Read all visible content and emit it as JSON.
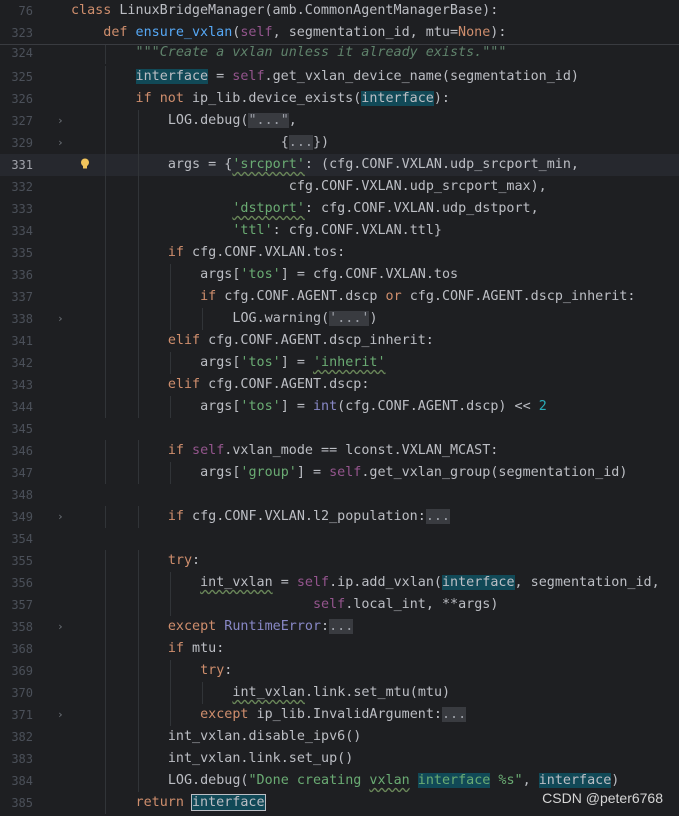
{
  "sticky": [
    {
      "ln": "76",
      "indent": 0,
      "tokens": [
        [
          "kw",
          "class"
        ],
        [
          "t",
          " LinuxBridgeManager(amb.CommonAgentManagerBase):"
        ]
      ]
    },
    {
      "ln": "323",
      "indent": 1,
      "tokens": [
        [
          "kw",
          "def"
        ],
        [
          "t",
          " "
        ],
        [
          "fn",
          "ensure_vxlan"
        ],
        [
          "t",
          "("
        ],
        [
          "self",
          "self"
        ],
        [
          "t",
          ", segmentation_id, mtu="
        ],
        [
          "kw",
          "None"
        ],
        [
          "t",
          "):"
        ]
      ]
    }
  ],
  "lines": [
    {
      "ln": "324",
      "indent": 2,
      "partial": true,
      "tokens": [
        [
          "doc",
          "\"\"\"Create a vxlan unless it already exists.\"\"\""
        ]
      ]
    },
    {
      "ln": "325",
      "indent": 2,
      "tokens": [
        [
          "hl",
          "interface"
        ],
        [
          "t",
          " = "
        ],
        [
          "self",
          "self"
        ],
        [
          "t",
          ".get_vxlan_device_name(segmentation_id)"
        ]
      ]
    },
    {
      "ln": "326",
      "indent": 2,
      "tokens": [
        [
          "kw",
          "if not"
        ],
        [
          "t",
          " ip_lib.device_exists("
        ],
        [
          "hl",
          "interface"
        ],
        [
          "t",
          "):"
        ]
      ]
    },
    {
      "ln": "327",
      "indent": 3,
      "fold": true,
      "tokens": [
        [
          "t",
          "LOG.debug("
        ],
        [
          "strfold",
          "\"...\""
        ],
        [
          "t",
          ","
        ]
      ]
    },
    {
      "ln": "329",
      "indent": 3,
      "fold": true,
      "extra": "              ",
      "tokens": [
        [
          "t",
          "{"
        ],
        [
          "fold",
          "..."
        ],
        [
          "t",
          "})"
        ]
      ]
    },
    {
      "ln": "331",
      "indent": 3,
      "current": true,
      "bulb": true,
      "tokens": [
        [
          "t",
          "args = {"
        ],
        [
          "strw",
          "'srcport'"
        ],
        [
          "t",
          ": (cfg.CONF.VXLAN.udp_srcport_min,"
        ]
      ]
    },
    {
      "ln": "332",
      "indent": 3,
      "extra": "               ",
      "tokens": [
        [
          "t",
          "cfg.CONF.VXLAN.udp_srcport_max),"
        ]
      ]
    },
    {
      "ln": "333",
      "indent": 3,
      "extra": "        ",
      "tokens": [
        [
          "strw",
          "'dstport'"
        ],
        [
          "t",
          ": cfg.CONF.VXLAN.udp_dstport,"
        ]
      ]
    },
    {
      "ln": "334",
      "indent": 3,
      "extra": "        ",
      "tokens": [
        [
          "str",
          "'ttl'"
        ],
        [
          "t",
          ": cfg.CONF.VXLAN.ttl}"
        ]
      ]
    },
    {
      "ln": "335",
      "indent": 3,
      "tokens": [
        [
          "kw",
          "if"
        ],
        [
          "t",
          " cfg.CONF.VXLAN.tos:"
        ]
      ]
    },
    {
      "ln": "336",
      "indent": 4,
      "tokens": [
        [
          "t",
          "args["
        ],
        [
          "str",
          "'tos'"
        ],
        [
          "t",
          "] = cfg.CONF.VXLAN.tos"
        ]
      ]
    },
    {
      "ln": "337",
      "indent": 4,
      "tokens": [
        [
          "kw",
          "if"
        ],
        [
          "t",
          " cfg.CONF.AGENT.dscp "
        ],
        [
          "kw",
          "or"
        ],
        [
          "t",
          " cfg.CONF.AGENT.dscp_inherit:"
        ]
      ]
    },
    {
      "ln": "338",
      "indent": 5,
      "fold": true,
      "tokens": [
        [
          "t",
          "LOG.warning("
        ],
        [
          "strfold",
          "'...'"
        ],
        [
          "t",
          ")"
        ]
      ]
    },
    {
      "ln": "341",
      "indent": 3,
      "tokens": [
        [
          "kw",
          "elif"
        ],
        [
          "t",
          " cfg.CONF.AGENT.dscp_inherit:"
        ]
      ]
    },
    {
      "ln": "342",
      "indent": 4,
      "tokens": [
        [
          "t",
          "args["
        ],
        [
          "str",
          "'tos'"
        ],
        [
          "t",
          "] = "
        ],
        [
          "strw",
          "'inherit'"
        ]
      ]
    },
    {
      "ln": "343",
      "indent": 3,
      "tokens": [
        [
          "kw",
          "elif"
        ],
        [
          "t",
          " cfg.CONF.AGENT.dscp:"
        ]
      ]
    },
    {
      "ln": "344",
      "indent": 4,
      "tokens": [
        [
          "t",
          "args["
        ],
        [
          "str",
          "'tos'"
        ],
        [
          "t",
          "] = "
        ],
        [
          "builtin",
          "int"
        ],
        [
          "t",
          "(cfg.CONF.AGENT.dscp) << "
        ],
        [
          "num",
          "2"
        ]
      ]
    },
    {
      "ln": "345",
      "indent": 0,
      "tokens": []
    },
    {
      "ln": "346",
      "indent": 3,
      "tokens": [
        [
          "kw",
          "if"
        ],
        [
          "t",
          " "
        ],
        [
          "self",
          "self"
        ],
        [
          "t",
          ".vxlan_mode == lconst.VXLAN_MCAST:"
        ]
      ]
    },
    {
      "ln": "347",
      "indent": 4,
      "tokens": [
        [
          "t",
          "args["
        ],
        [
          "str",
          "'group'"
        ],
        [
          "t",
          "] = "
        ],
        [
          "self",
          "self"
        ],
        [
          "t",
          ".get_vxlan_group(segmentation_id)"
        ]
      ]
    },
    {
      "ln": "348",
      "indent": 0,
      "tokens": []
    },
    {
      "ln": "349",
      "indent": 3,
      "fold": true,
      "tokens": [
        [
          "kw",
          "if"
        ],
        [
          "t",
          " cfg.CONF.VXLAN.l2_population:"
        ],
        [
          "fold",
          "..."
        ]
      ]
    },
    {
      "ln": "354",
      "indent": 0,
      "tokens": []
    },
    {
      "ln": "355",
      "indent": 3,
      "tokens": [
        [
          "kw",
          "try"
        ],
        [
          "t",
          ":"
        ]
      ]
    },
    {
      "ln": "356",
      "indent": 4,
      "tokens": [
        [
          "w",
          "int_vxlan"
        ],
        [
          "t",
          " = "
        ],
        [
          "self",
          "self"
        ],
        [
          "t",
          ".ip.add_vxlan("
        ],
        [
          "hl",
          "interface"
        ],
        [
          "t",
          ", segmentation_id,"
        ]
      ]
    },
    {
      "ln": "357",
      "indent": 4,
      "extra": "              ",
      "tokens": [
        [
          "self",
          "self"
        ],
        [
          "t",
          ".local_int, **args)"
        ]
      ]
    },
    {
      "ln": "358",
      "indent": 3,
      "fold": true,
      "tokens": [
        [
          "kw",
          "except"
        ],
        [
          "t",
          " "
        ],
        [
          "builtin",
          "RuntimeError"
        ],
        [
          "t",
          ":"
        ],
        [
          "fold",
          "..."
        ]
      ]
    },
    {
      "ln": "368",
      "indent": 3,
      "tokens": [
        [
          "kw",
          "if"
        ],
        [
          "t",
          " mtu:"
        ]
      ]
    },
    {
      "ln": "369",
      "indent": 4,
      "tokens": [
        [
          "kw",
          "try"
        ],
        [
          "t",
          ":"
        ]
      ]
    },
    {
      "ln": "370",
      "indent": 5,
      "tokens": [
        [
          "w",
          "int_vxlan"
        ],
        [
          "t",
          ".link.set_mtu(mtu)"
        ]
      ]
    },
    {
      "ln": "371",
      "indent": 4,
      "fold": true,
      "tokens": [
        [
          "kw",
          "except"
        ],
        [
          "t",
          " ip_lib.InvalidArgument:"
        ],
        [
          "fold",
          "..."
        ]
      ]
    },
    {
      "ln": "382",
      "indent": 3,
      "tokens": [
        [
          "t",
          "int_vxlan.disable_ipv6()"
        ]
      ]
    },
    {
      "ln": "383",
      "indent": 3,
      "tokens": [
        [
          "t",
          "int_vxlan.link.set_up()"
        ]
      ]
    },
    {
      "ln": "384",
      "indent": 3,
      "tokens": [
        [
          "t",
          "LOG.debug("
        ],
        [
          "str",
          "\"Done creating "
        ],
        [
          "strw",
          "vxlan"
        ],
        [
          "str",
          " "
        ],
        [
          "strhl",
          "interface"
        ],
        [
          "str",
          " %s\""
        ],
        [
          "t",
          ", "
        ],
        [
          "hl",
          "interface"
        ],
        [
          "t",
          ")"
        ]
      ]
    },
    {
      "ln": "385",
      "indent": 2,
      "tokens": [
        [
          "kw",
          "return"
        ],
        [
          "t",
          " "
        ],
        [
          "hlbox",
          "interface"
        ]
      ]
    }
  ],
  "watermark": "CSDN @peter6768",
  "colors": {
    "background": "#1e1f22",
    "keyword": "#cf8e6d",
    "function": "#56a8f5",
    "string": "#6aab73",
    "self": "#94558d",
    "number": "#2aacb8",
    "highlight": "#114957"
  }
}
